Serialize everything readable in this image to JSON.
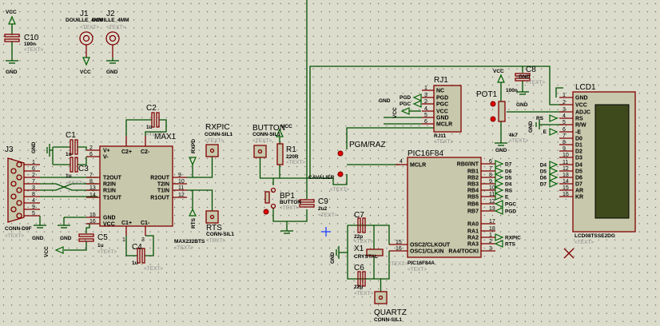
{
  "placeholder": "<TEXT>",
  "power": {
    "vcc": "VCC",
    "gnd": "GND"
  },
  "c10": {
    "ref": "C10",
    "value": "100n"
  },
  "j1": {
    "ref": "J1",
    "value": "DOUILLE_4MM"
  },
  "j2": {
    "ref": "J2",
    "value": "DOUILLE_4MM"
  },
  "j3": {
    "ref": "J3",
    "value": "CONN-D9F",
    "pins": [
      "1",
      "6",
      "2",
      "7",
      "3",
      "8",
      "4",
      "9",
      "5"
    ]
  },
  "max1": {
    "ref": "MAX1",
    "value": "MAX232BTS",
    "left_pins": [
      "V+",
      "V-",
      "T2OUT",
      "R2IN",
      "R1IN",
      "T1OUT",
      "GND",
      "VCC"
    ],
    "left_nums": [
      "2",
      "6",
      "7",
      "8",
      "13",
      "14",
      "15",
      "16"
    ],
    "right_pins": [
      "R2OUT",
      "T2IN",
      "T1IN",
      "R1OUT"
    ],
    "right_nums": [
      "9",
      "10",
      "11",
      "12"
    ],
    "top_pins": [
      "C2+",
      "C2-"
    ],
    "bottom_pins": [
      "C1+",
      "C1-"
    ],
    "bottom_nums": [
      "1",
      "3"
    ]
  },
  "c1": {
    "ref": "C1",
    "value": "1u"
  },
  "c2": {
    "ref": "C2",
    "value": "1u"
  },
  "c3": {
    "ref": "C3",
    "value": "1u"
  },
  "c4": {
    "ref": "C4",
    "value": "1u"
  },
  "c5": {
    "ref": "C5",
    "value": "1u"
  },
  "rxpic": {
    "ref": "RXPIC",
    "value": "CONN-SIL1"
  },
  "rts": {
    "ref": "RTS",
    "value": "CONN-SIL1"
  },
  "net_labels": {
    "rxpd": "RXPD",
    "rts": "RTS",
    "rxpic": "RXPIC",
    "rs": "RS",
    "e": "E",
    "pgc": "PGC",
    "pgd": "PGD",
    "d4": "D4",
    "d5": "D5",
    "d6": "D6",
    "d7": "D7"
  },
  "button": {
    "ref": "BUTTON",
    "value": "CONN-SIL1"
  },
  "r1": {
    "ref": "R1",
    "value": "220R"
  },
  "bp1": {
    "ref": "BP1",
    "value": "BUTTON"
  },
  "c9": {
    "ref": "C9",
    "value": "2u2"
  },
  "jumper": {
    "ref": "PGM/RAZ",
    "value": "CAVALIER"
  },
  "pic": {
    "ref": "PIC16F84",
    "value": "PIC16F84A",
    "mclr": "MCLR",
    "mclr_num": "4",
    "right_pins": [
      "RB0/INT",
      "RB1",
      "RB2",
      "RB3",
      "RB4",
      "RB5",
      "RB6",
      "RB7",
      "RA0",
      "RA1",
      "RA2",
      "RA3",
      "RA4/TOCKI"
    ],
    "right_nums": [
      "6",
      "7",
      "8",
      "9",
      "10",
      "11",
      "12",
      "13",
      "17",
      "18",
      "1",
      "2",
      "3"
    ],
    "osc_pins": [
      "OSC2/CLKOUT",
      "OSC1/CLKIN"
    ],
    "osc_nums": [
      "15",
      "16"
    ]
  },
  "c7": {
    "ref": "C7",
    "value": "22p"
  },
  "c6": {
    "ref": "C6",
    "value": "22p"
  },
  "x1": {
    "ref": "X1",
    "value": "CRYSTAL"
  },
  "quartz": {
    "ref": "QUARTZ",
    "value": "CONN-SIL1"
  },
  "rj1": {
    "ref": "RJ1",
    "value": "RJ11",
    "pins": [
      "NC",
      "PGD",
      "PGC",
      "VCC",
      "GND",
      "MCLR"
    ],
    "nums": [
      "1",
      "3",
      "2",
      "4",
      "5",
      "6"
    ]
  },
  "pot1": {
    "ref": "POT1",
    "value": "4k7"
  },
  "c8": {
    "ref": "C8",
    "value": "100n"
  },
  "lcd1": {
    "ref": "LCD1",
    "value": "LCD08TSSE2DG",
    "pins": [
      "GND",
      "VCC",
      "ADJC",
      "RS",
      "R/W",
      "-E",
      "D0",
      "D1",
      "D2",
      "D3",
      "D4",
      "D5",
      "D6",
      "D7",
      "AR",
      "KR"
    ],
    "nums": [
      "1",
      "2",
      "3",
      "4",
      "5",
      "6",
      "7",
      "8",
      "9",
      "10",
      "11",
      "12",
      "13",
      "14",
      "15",
      "16"
    ]
  },
  "colors": {
    "wire": "#005000",
    "component": "#800000",
    "body": "#c8c8ac",
    "background": "#dcdccc",
    "lcd_screen": "#3e4a1c",
    "pin_marker": "#e00000"
  }
}
